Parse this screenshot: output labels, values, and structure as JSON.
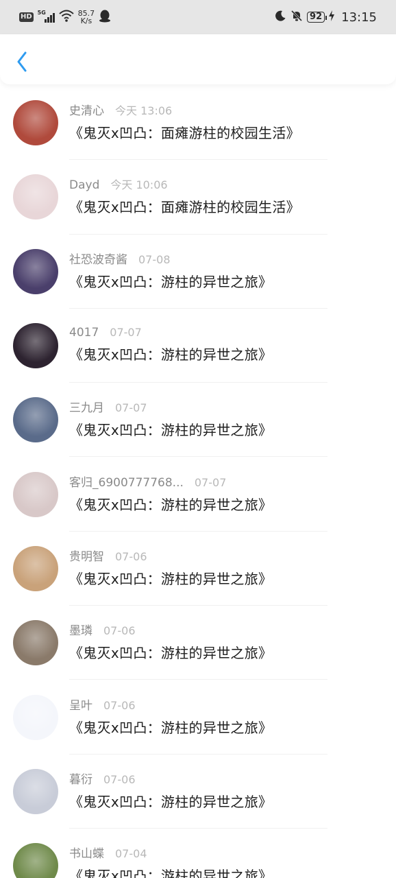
{
  "status_bar": {
    "hd": "HD",
    "network": "5G",
    "speed_value": "85.7",
    "speed_unit": "K/s",
    "battery": "92",
    "time": "13:15",
    "icons": [
      "signal-icon",
      "wifi-icon",
      "app-notification-icon",
      "moon-icon",
      "mute-icon",
      "battery-icon",
      "charging-icon"
    ]
  },
  "header": {
    "back_icon": "chevron-left-icon",
    "accent_color": "#2e9bf0"
  },
  "items": [
    {
      "name": "史清心",
      "date": "今天 13:06",
      "title": "《鬼灭x凹凸：面瘫游柱的校园生活》",
      "avatar_color": "#b04a3c"
    },
    {
      "name": "Dayd",
      "date": "今天 10:06",
      "title": "《鬼灭x凹凸：面瘫游柱的校园生活》",
      "avatar_color": "#e8d6d8"
    },
    {
      "name": "社恐波奇酱",
      "date": "07-08",
      "title": "《鬼灭x凹凸：游柱的异世之旅》",
      "avatar_color": "#4a3f6b"
    },
    {
      "name": "4017",
      "date": "07-07",
      "title": "《鬼灭x凹凸：游柱的异世之旅》",
      "avatar_color": "#2d2330"
    },
    {
      "name": "三九月",
      "date": "07-07",
      "title": "《鬼灭x凹凸：游柱的异世之旅》",
      "avatar_color": "#5a6b8a"
    },
    {
      "name": "客归_6900777768...",
      "date": "07-07",
      "title": "《鬼灭x凹凸：游柱的异世之旅》",
      "avatar_color": "#d8c8c8"
    },
    {
      "name": "贵明智",
      "date": "07-06",
      "title": "《鬼灭x凹凸：游柱的异世之旅》",
      "avatar_color": "#c9a27a"
    },
    {
      "name": "墨璘",
      "date": "07-06",
      "title": "《鬼灭x凹凸：游柱的异世之旅》",
      "avatar_color": "#8a7a6a"
    },
    {
      "name": "呈叶",
      "date": "07-06",
      "title": "《鬼灭x凹凸：游柱的异世之旅》",
      "avatar_color": "#f4f6fb"
    },
    {
      "name": "暮衍",
      "date": "07-06",
      "title": "《鬼灭x凹凸：游柱的异世之旅》",
      "avatar_color": "#c8ccd8"
    },
    {
      "name": "书山蝶",
      "date": "07-04",
      "title": "《鬼灭x凹凸：游柱的异世之旅》",
      "avatar_color": "#6f8a4a"
    }
  ]
}
